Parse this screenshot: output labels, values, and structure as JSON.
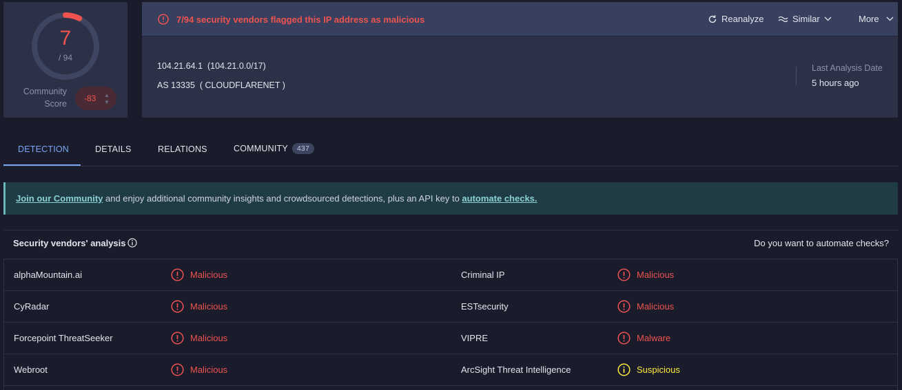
{
  "score": {
    "detections": "7",
    "total": "/ 94",
    "fraction": 0.0745,
    "community_label": "Community Score",
    "community_value": "-83"
  },
  "header": {
    "alert": "7/94 security vendors flagged this IP address as malicious",
    "actions": {
      "reanalyze": "Reanalyze",
      "similar": "Similar",
      "more": "More"
    }
  },
  "ip": {
    "address_line": "104.21.64.1  (104.21.0.0/17)",
    "as_line": "AS 13335  ( CLOUDFLARENET )",
    "last_analysis_label": "Last Analysis Date",
    "last_analysis_value": "5 hours ago"
  },
  "tabs": [
    {
      "label": "DETECTION"
    },
    {
      "label": "DETAILS"
    },
    {
      "label": "RELATIONS"
    },
    {
      "label": "COMMUNITY",
      "badge": "437"
    }
  ],
  "banner": {
    "link1": "Join our Community",
    "text": " and enjoy additional community insights and crowdsourced detections, plus an API key to ",
    "link2": "automate checks."
  },
  "vendors_section": {
    "title": "Security vendors' analysis",
    "automate_question": "Do you want to automate checks?"
  },
  "vendors": [
    {
      "left_name": "alphaMountain.ai",
      "left_status": "Malicious",
      "right_name": "Criminal IP",
      "right_status": "Malicious"
    },
    {
      "left_name": "CyRadar",
      "left_status": "Malicious",
      "right_name": "ESTsecurity",
      "right_status": "Malicious"
    },
    {
      "left_name": "Forcepoint ThreatSeeker",
      "left_status": "Malicious",
      "right_name": "VIPRE",
      "right_status": "Malware"
    },
    {
      "left_name": "Webroot",
      "left_status": "Malicious",
      "right_name": "ArcSight Threat Intelligence",
      "right_status": "Suspicious"
    }
  ],
  "colors": {
    "malicious": "#ef5350",
    "suspicious": "#ffeb3b",
    "accent": "#7ca4f5",
    "background": "#1a1b2b",
    "panel": "#2c3148"
  }
}
